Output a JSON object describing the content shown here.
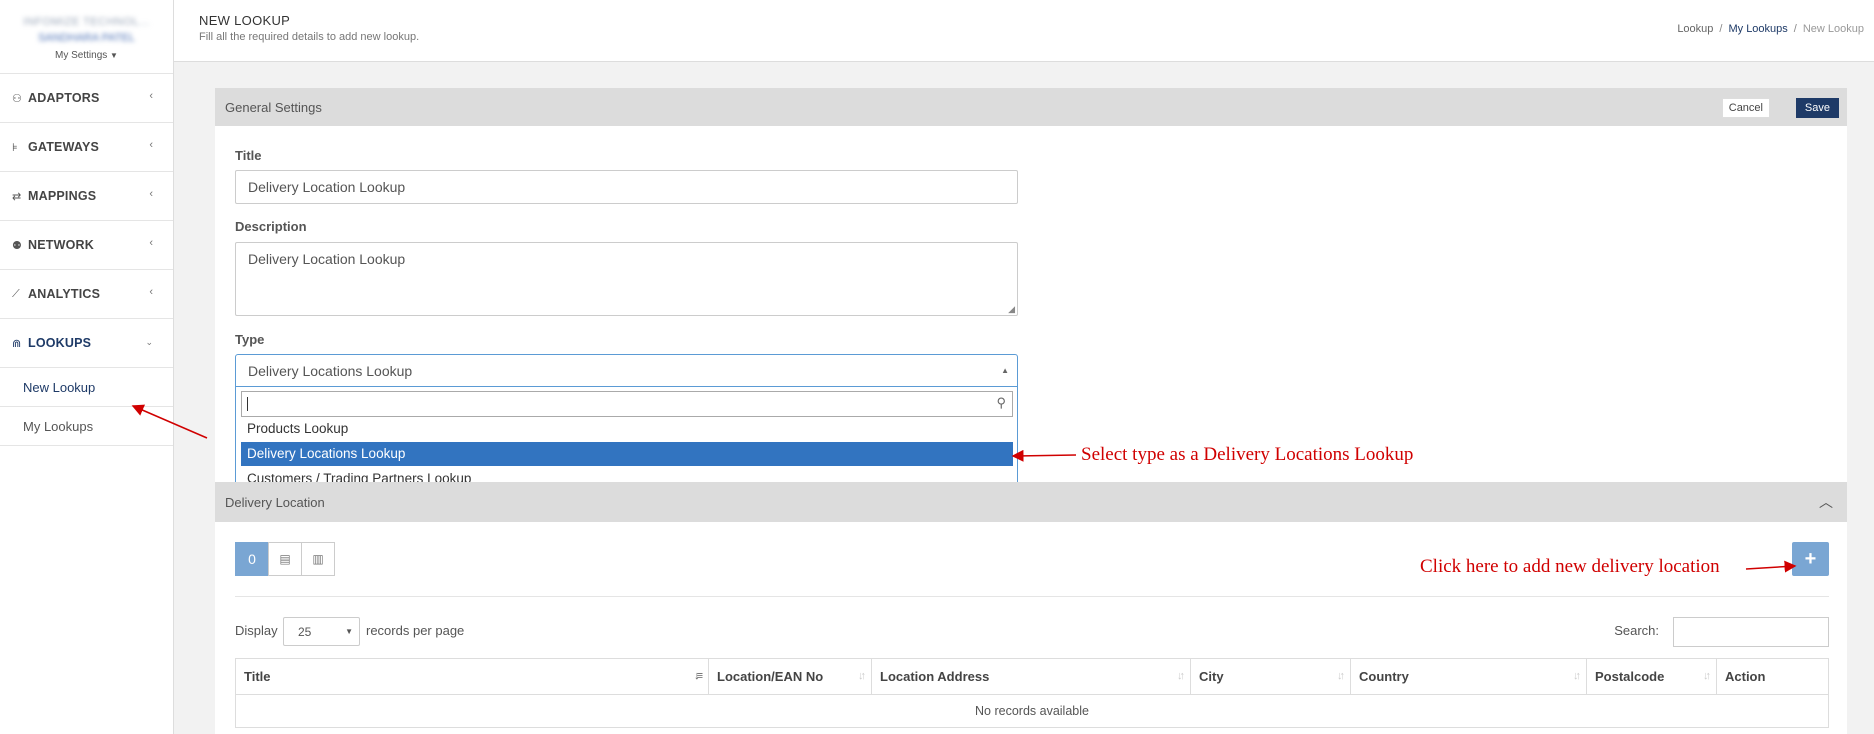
{
  "sidebar": {
    "user_company": "INFOMIZE TECHNOL...",
    "user_name": "SANDHARA PATEL",
    "settings_label": "My Settings",
    "items": [
      {
        "label": "ADAPTORS",
        "icon": "puzzle-icon",
        "glyph": "⚇"
      },
      {
        "label": "GATEWAYS",
        "icon": "signpost-icon",
        "glyph": "⊧"
      },
      {
        "label": "MAPPINGS",
        "icon": "exchange-icon",
        "glyph": "⇄"
      },
      {
        "label": "NETWORK",
        "icon": "users-icon",
        "glyph": "⚉"
      },
      {
        "label": "ANALYTICS",
        "icon": "line-chart-icon",
        "glyph": "⟋"
      },
      {
        "label": "LOOKUPS",
        "icon": "binoculars-icon",
        "glyph": "⋒"
      }
    ],
    "sub_items": [
      {
        "label": "New Lookup"
      },
      {
        "label": "My Lookups"
      }
    ]
  },
  "header": {
    "title": "NEW LOOKUP",
    "subtitle": "Fill all the required details to add new lookup.",
    "breadcrumb": [
      "Lookup",
      "My Lookups",
      "New Lookup"
    ]
  },
  "general": {
    "heading": "General Settings",
    "cancel_label": "Cancel",
    "save_label": "Save",
    "title_label": "Title",
    "title_value": "Delivery Location Lookup",
    "description_label": "Description",
    "description_value": "Delivery Location Lookup",
    "type_label": "Type",
    "type_value": "Delivery Locations Lookup",
    "type_options": [
      "Products Lookup",
      "Delivery Locations Lookup",
      "Customers / Trading Partners Lookup"
    ]
  },
  "delivery": {
    "heading": "Delivery Location",
    "count_badge": "0",
    "display_label": "Display",
    "per_page_value": "25",
    "per_page_label": "records per page",
    "search_label": "Search:",
    "columns": [
      "Title",
      "Location/EAN No",
      "Location Address",
      "City",
      "Country",
      "Postalcode",
      "Action"
    ],
    "empty_text": "No records available"
  },
  "annotations": {
    "type_note": "Select type as a Delivery Locations Lookup",
    "add_note": "Click here to add new delivery location"
  },
  "colors": {
    "brand": "#1e3a67",
    "selected_option": "#3274c0",
    "button_light": "#7aa6d3",
    "annotation": "#d00000"
  }
}
